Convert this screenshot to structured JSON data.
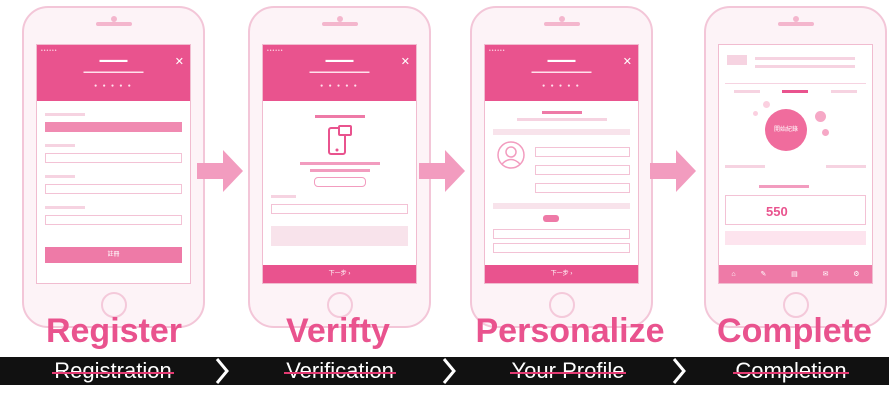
{
  "colors": {
    "accent": "#e9538e",
    "light_pink": "#f6d3e1",
    "arrow": "#f29cbf",
    "band": "#111111",
    "strike": "#e43b73"
  },
  "steps": [
    {
      "label": "Register",
      "caption": "Registration"
    },
    {
      "label": "Verifty",
      "caption": "Verification"
    },
    {
      "label": "Personalize",
      "caption": "Your Profile"
    },
    {
      "label": "Complete",
      "caption": "Completion"
    }
  ],
  "phone_register": {
    "next": "註冊"
  },
  "phone_verify": {
    "next": "下一步 ›"
  },
  "phone_profile": {
    "next": "下一步 ›"
  },
  "phone_complete": {
    "circle": "開始紀錄",
    "value": "550"
  }
}
